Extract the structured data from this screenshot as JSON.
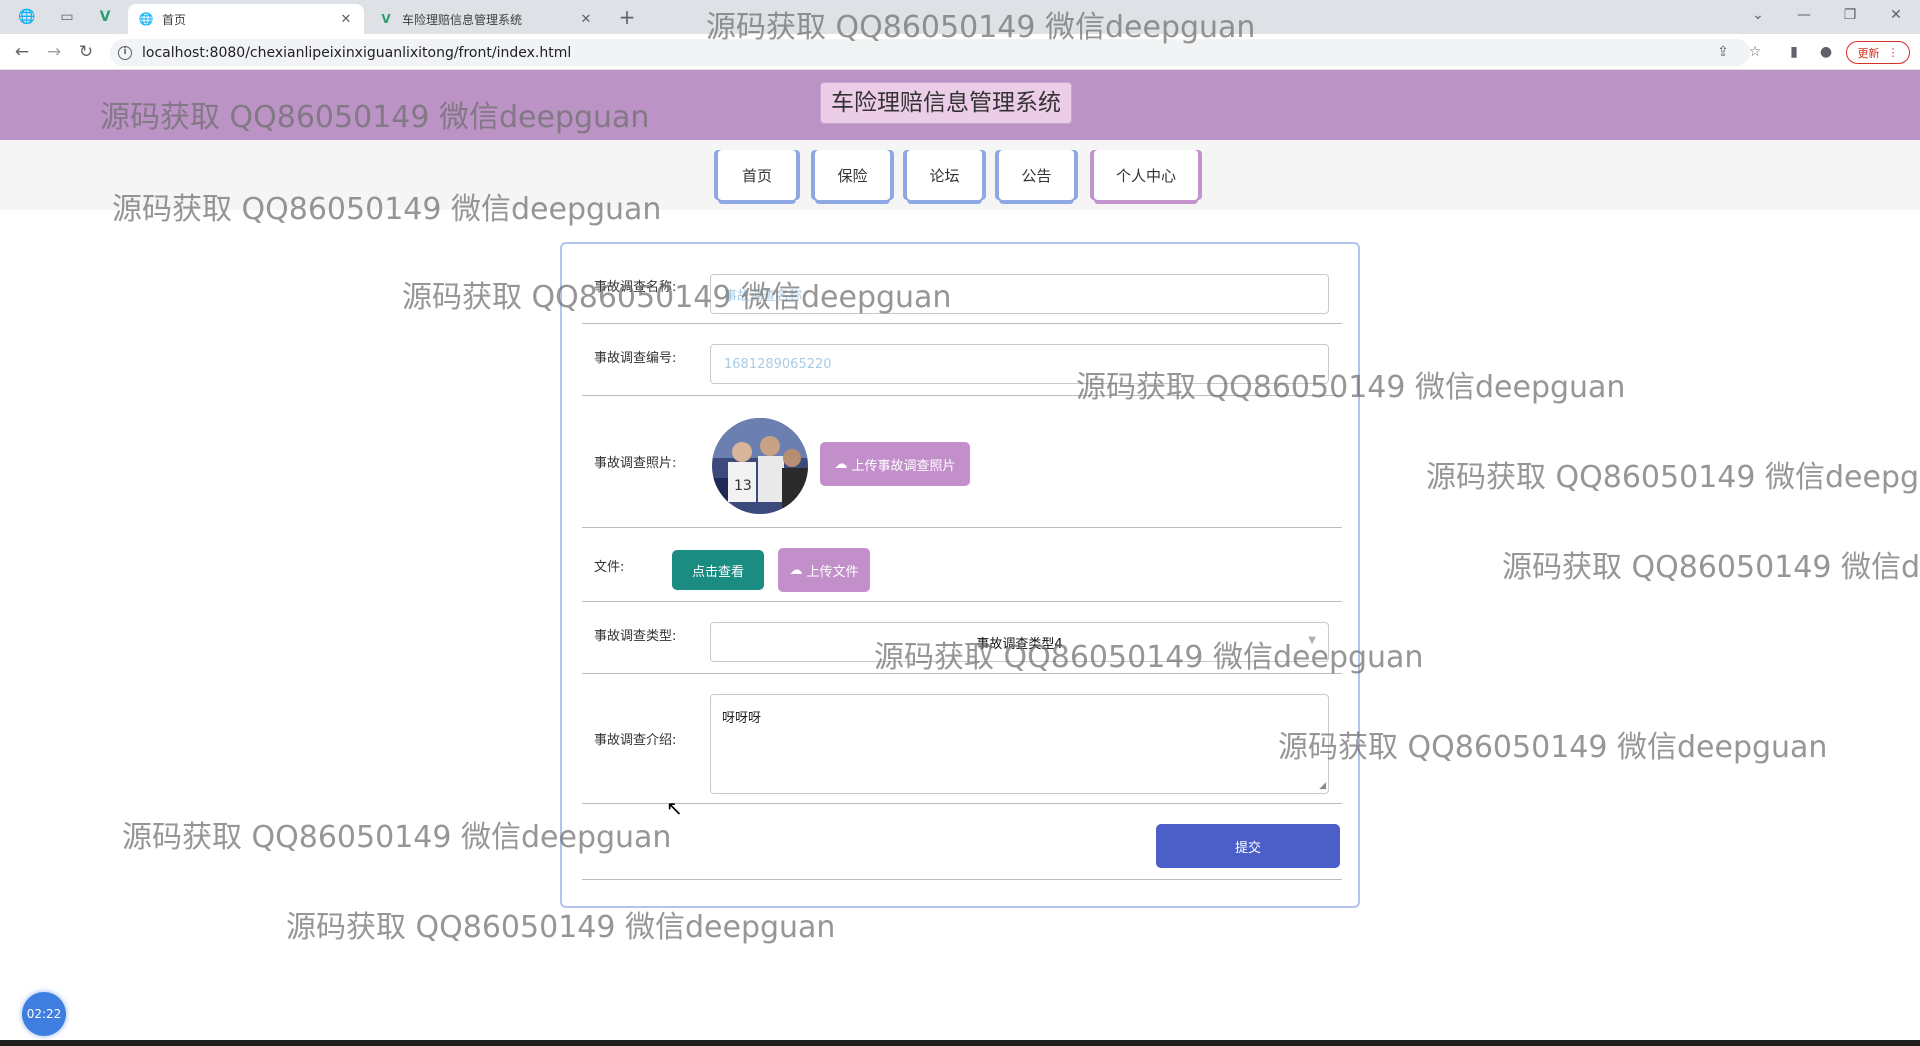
{
  "browser": {
    "tabs": [
      {
        "title": "首页",
        "active": true
      },
      {
        "title": "车险理赔信息管理系统",
        "active": false
      }
    ],
    "url": "localhost:8080/chexianlipeixinxiguanlixitong/front/index.html",
    "update_label": "更新"
  },
  "header": {
    "site_title": "车险理赔信息管理系统",
    "nav": [
      {
        "label": "首页"
      },
      {
        "label": "保险"
      },
      {
        "label": "论坛"
      },
      {
        "label": "公告"
      },
      {
        "label": "个人中心"
      }
    ]
  },
  "form": {
    "name_label": "事故调查名称:",
    "name_placeholder": "事故调查名称",
    "number_label": "事故调查编号:",
    "number_value": "1681289065220",
    "photo_label": "事故调查照片:",
    "photo_upload_label": "上传事故调查照片",
    "file_label": "文件:",
    "file_view_label": "点击查看",
    "file_upload_label": "上传文件",
    "type_label": "事故调查类型:",
    "type_value": "事故调查类型4",
    "intro_label": "事故调查介绍:",
    "intro_value": "呀呀呀",
    "submit_label": "提交"
  },
  "watermark_text": "源码获取 QQ86050149 微信deepguan",
  "timer": "02:22",
  "colors": {
    "header_bg": "#bb93c4",
    "card_border": "#b3c3ee",
    "submit": "#4c5ec7",
    "teal": "#1b8c82",
    "upload": "#c38fcb"
  }
}
